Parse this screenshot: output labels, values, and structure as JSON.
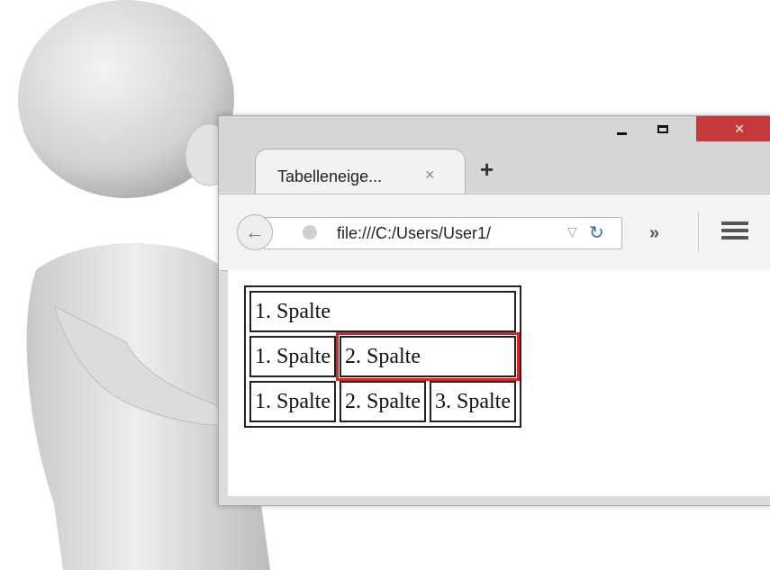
{
  "window": {
    "controls": {
      "minimize": "minimize",
      "maximize": "maximize",
      "close": "×"
    }
  },
  "tab": {
    "title": "Tabelleneige...",
    "close": "×",
    "new_tab": "+"
  },
  "navbar": {
    "back_icon": "arrow-left-icon",
    "url": "file:///C:/Users/User1/",
    "dropdown": "▽",
    "reload": "↻",
    "overflow": "»",
    "menu_icon": "hamburger-icon"
  },
  "table": {
    "rows": [
      [
        "1. Spalte"
      ],
      [
        "1. Spalte",
        "2. Spalte"
      ],
      [
        "1. Spalte",
        "2. Spalte",
        "3. Spalte"
      ]
    ],
    "highlight_color": "#e02020"
  },
  "colors": {
    "close_button": "#c8393b",
    "titlebar": "#d6d6d6"
  }
}
